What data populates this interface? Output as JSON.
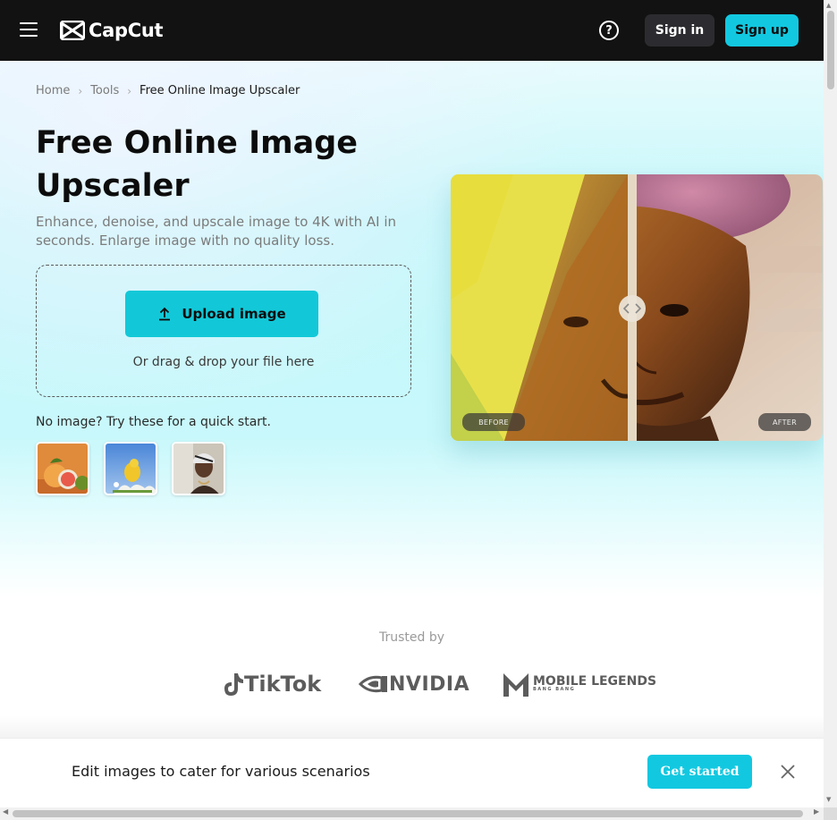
{
  "header": {
    "logo_text": "CapCut",
    "sign_in_label": "Sign in",
    "sign_up_label": "Sign up",
    "help_symbol": "?"
  },
  "breadcrumb": {
    "items": [
      "Home",
      "Tools",
      "Free Online Image Upscaler"
    ]
  },
  "hero": {
    "title": "Free Online Image Upscaler",
    "subtitle": "Enhance, denoise, and upscale image to 4K with AI in seconds. Enlarge image with no quality loss.",
    "upload_label": "Upload image",
    "drag_text": "Or drag & drop your file here",
    "quick_start_text": "No image? Try these for a quick start.",
    "samples": [
      "citrus-fruits-thumbnail",
      "yellow-bird-thumbnail",
      "portrait-thumbnail"
    ]
  },
  "preview": {
    "before_label": "BEFORE",
    "after_label": "AFTER"
  },
  "trusted": {
    "label": "Trusted by",
    "brands": [
      "TikTok",
      "NVIDIA",
      "MOBILE LEGENDS",
      "BANG BANG"
    ]
  },
  "banner": {
    "text": "Edit images to cater for various scenarios",
    "cta_label": "Get started"
  },
  "colors": {
    "header_bg": "#121212",
    "accent": "#12c8e0",
    "hero_bg": "#c4f7fa"
  },
  "icons": [
    "menu-icon",
    "capcut-logo-icon",
    "help-icon",
    "chevron-right-icon",
    "upload-icon",
    "compare-handle-icon",
    "tiktok-icon",
    "nvidia-icon",
    "mobile-legends-icon",
    "close-icon"
  ]
}
